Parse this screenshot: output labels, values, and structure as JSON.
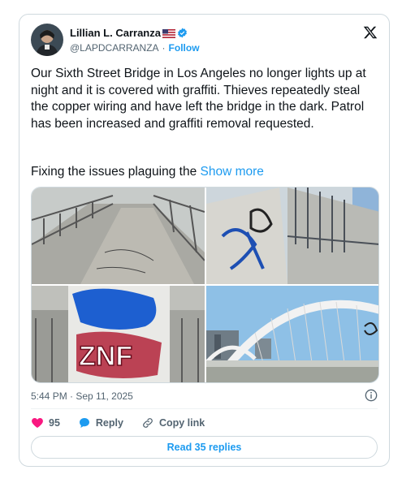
{
  "author": {
    "name": "Lillian L. Carranza",
    "handle": "@LAPDCARRANZA",
    "separator": "·",
    "follow_label": "Follow",
    "flag_icon": "us-flag-icon",
    "verified_icon": "verified-badge-icon"
  },
  "post": {
    "text": "Our Sixth Street Bridge in Los Angeles  no longer lights up at night and it is covered with graffiti.  Thieves  repeatedly steal the copper wiring and have left the bridge in the dark.   Patrol has been increased and  graffiti removal requested.",
    "truncated_text": "Fixing the issues plaguing the",
    "show_more_label": "Show more",
    "timestamp": "5:44 PM · Sep 11, 2025"
  },
  "media": {
    "images": [
      "bridge-walkway-photo",
      "graffiti-wall-photo",
      "graffiti-pillar-photo",
      "bridge-arches-photo"
    ],
    "graffiti_tag": "ZNF"
  },
  "actions": {
    "like_count": "95",
    "reply_label": "Reply",
    "copy_link_label": "Copy link",
    "read_replies_label": "Read 35 replies"
  },
  "colors": {
    "accent": "#1d9bf0",
    "like": "#f91880",
    "text": "#0f1419",
    "muted": "#536471",
    "border": "#cfd9de"
  }
}
